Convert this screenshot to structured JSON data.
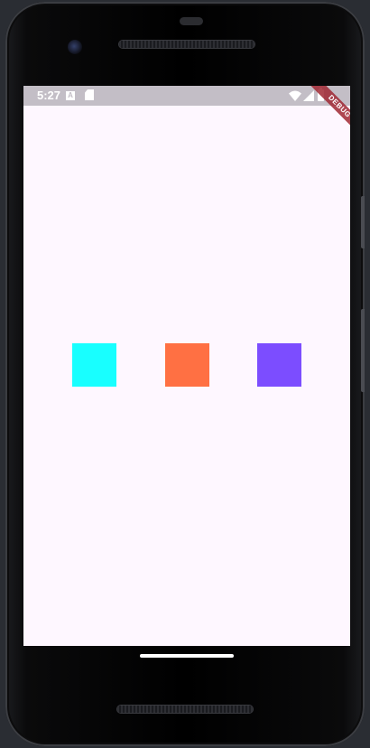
{
  "status_bar": {
    "time": "5:27",
    "notification_letter": "A",
    "background_color": "#c3bec6"
  },
  "debug_banner": {
    "label": "DEBUG"
  },
  "screen": {
    "background_color": "#fef7ff"
  },
  "squares": [
    {
      "color": "#18ffff",
      "color_name": "cyan"
    },
    {
      "color": "#ff7043",
      "color_name": "deep-orange"
    },
    {
      "color": "#7c4dff",
      "color_name": "deep-purple"
    }
  ],
  "icons": {
    "notification": "a-notification-icon",
    "storage": "sd-card-icon",
    "wifi": "wifi-icon",
    "signal": "cell-signal-icon",
    "battery": "battery-icon"
  }
}
